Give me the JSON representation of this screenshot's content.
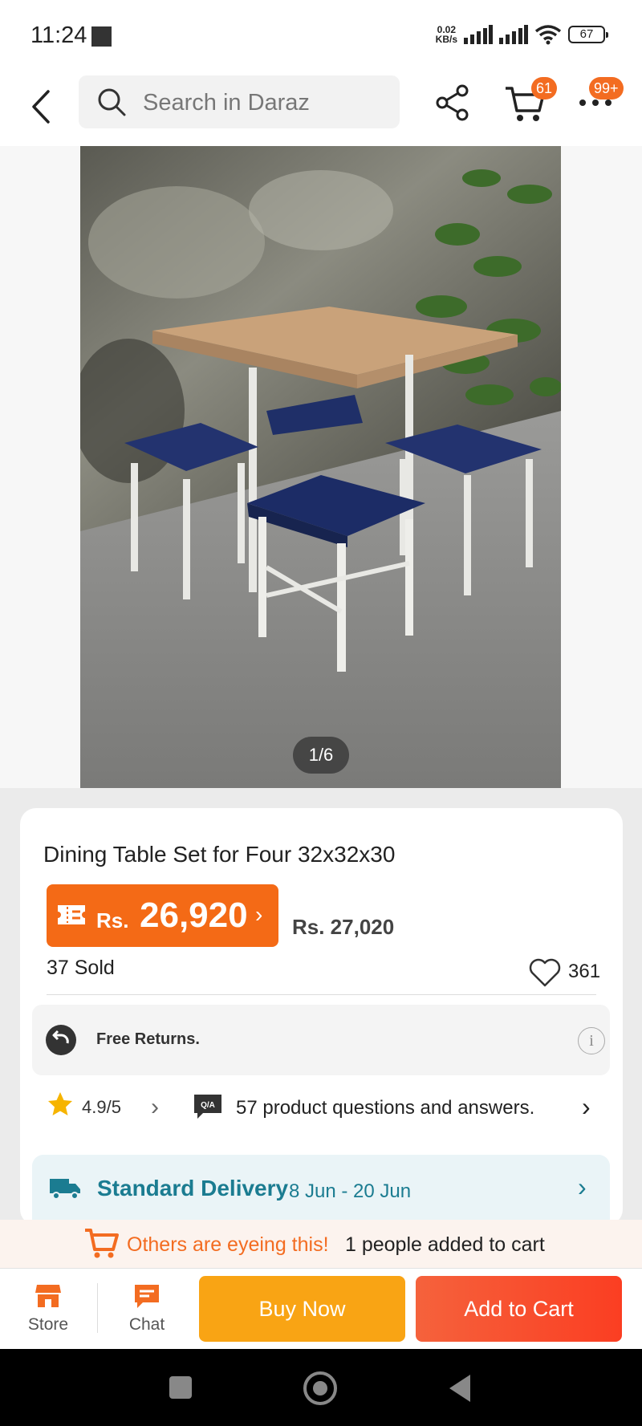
{
  "status_bar": {
    "time": "11:24",
    "net_speed_value": "0.02",
    "net_speed_unit": "KB/s",
    "battery": "67"
  },
  "top_nav": {
    "search_placeholder": "Search in Daraz",
    "cart_badge": "61",
    "more_badge": "99+"
  },
  "gallery": {
    "counter": "1/6"
  },
  "product": {
    "title": "Dining Table Set for Four 32x32x30",
    "price_currency": "Rs.",
    "price_value": "26,920",
    "original_price": "Rs. 27,020",
    "sold": "37 Sold",
    "wishlist_count": "361",
    "returns_label": "Free Returns.",
    "rating": "4.9/5",
    "qa_badge": "Q/A",
    "qa_text": "57 product questions and answers.",
    "delivery_label": "Standard Delivery",
    "delivery_dates": "8 Jun - 20 Jun"
  },
  "eyeing": {
    "highlight": "Others are eyeing this!",
    "message": "1 people added to cart"
  },
  "bottom_bar": {
    "store_label": "Store",
    "chat_label": "Chat",
    "buy_now_label": "Buy Now",
    "add_to_cart_label": "Add to Cart"
  },
  "colors": {
    "brand_orange": "#f46a16",
    "buy_now": "#f9a414",
    "add_to_cart": "#fb3e22",
    "delivery_teal": "#1b7c91"
  }
}
